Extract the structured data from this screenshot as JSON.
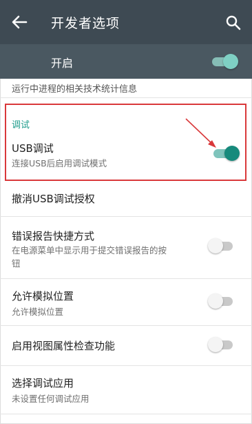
{
  "appbar": {
    "title": "开发者选项",
    "back_icon": "arrow-back-icon",
    "search_icon": "search-icon",
    "color": "#3e4a53"
  },
  "master": {
    "label": "开启",
    "enabled": true
  },
  "partial_item": {
    "summary": "运行中进程的相关技术统计信息"
  },
  "debug_section": {
    "header": "调试",
    "accent": "#1f9c8c",
    "usb_debug": {
      "title": "USB调试",
      "summary": "连接USB后启用调试模式",
      "enabled": true
    }
  },
  "items": {
    "revoke": {
      "title": "撤消USB调试授权"
    },
    "bug_report": {
      "title": "错误报告快捷方式",
      "summary_line1": "在电源菜单中显示用于提交错误报告的按",
      "summary_line2": "钮",
      "enabled": false
    },
    "mock_location": {
      "title": "允许模拟位置",
      "summary": "允许模拟位置",
      "enabled": false
    },
    "view_inspect": {
      "title": "启用视图属性检查功能",
      "enabled": false
    },
    "debug_app": {
      "title": "选择调试应用",
      "summary": "未设置任何调试应用"
    }
  },
  "annotation": {
    "highlight_color": "#d9383a"
  }
}
